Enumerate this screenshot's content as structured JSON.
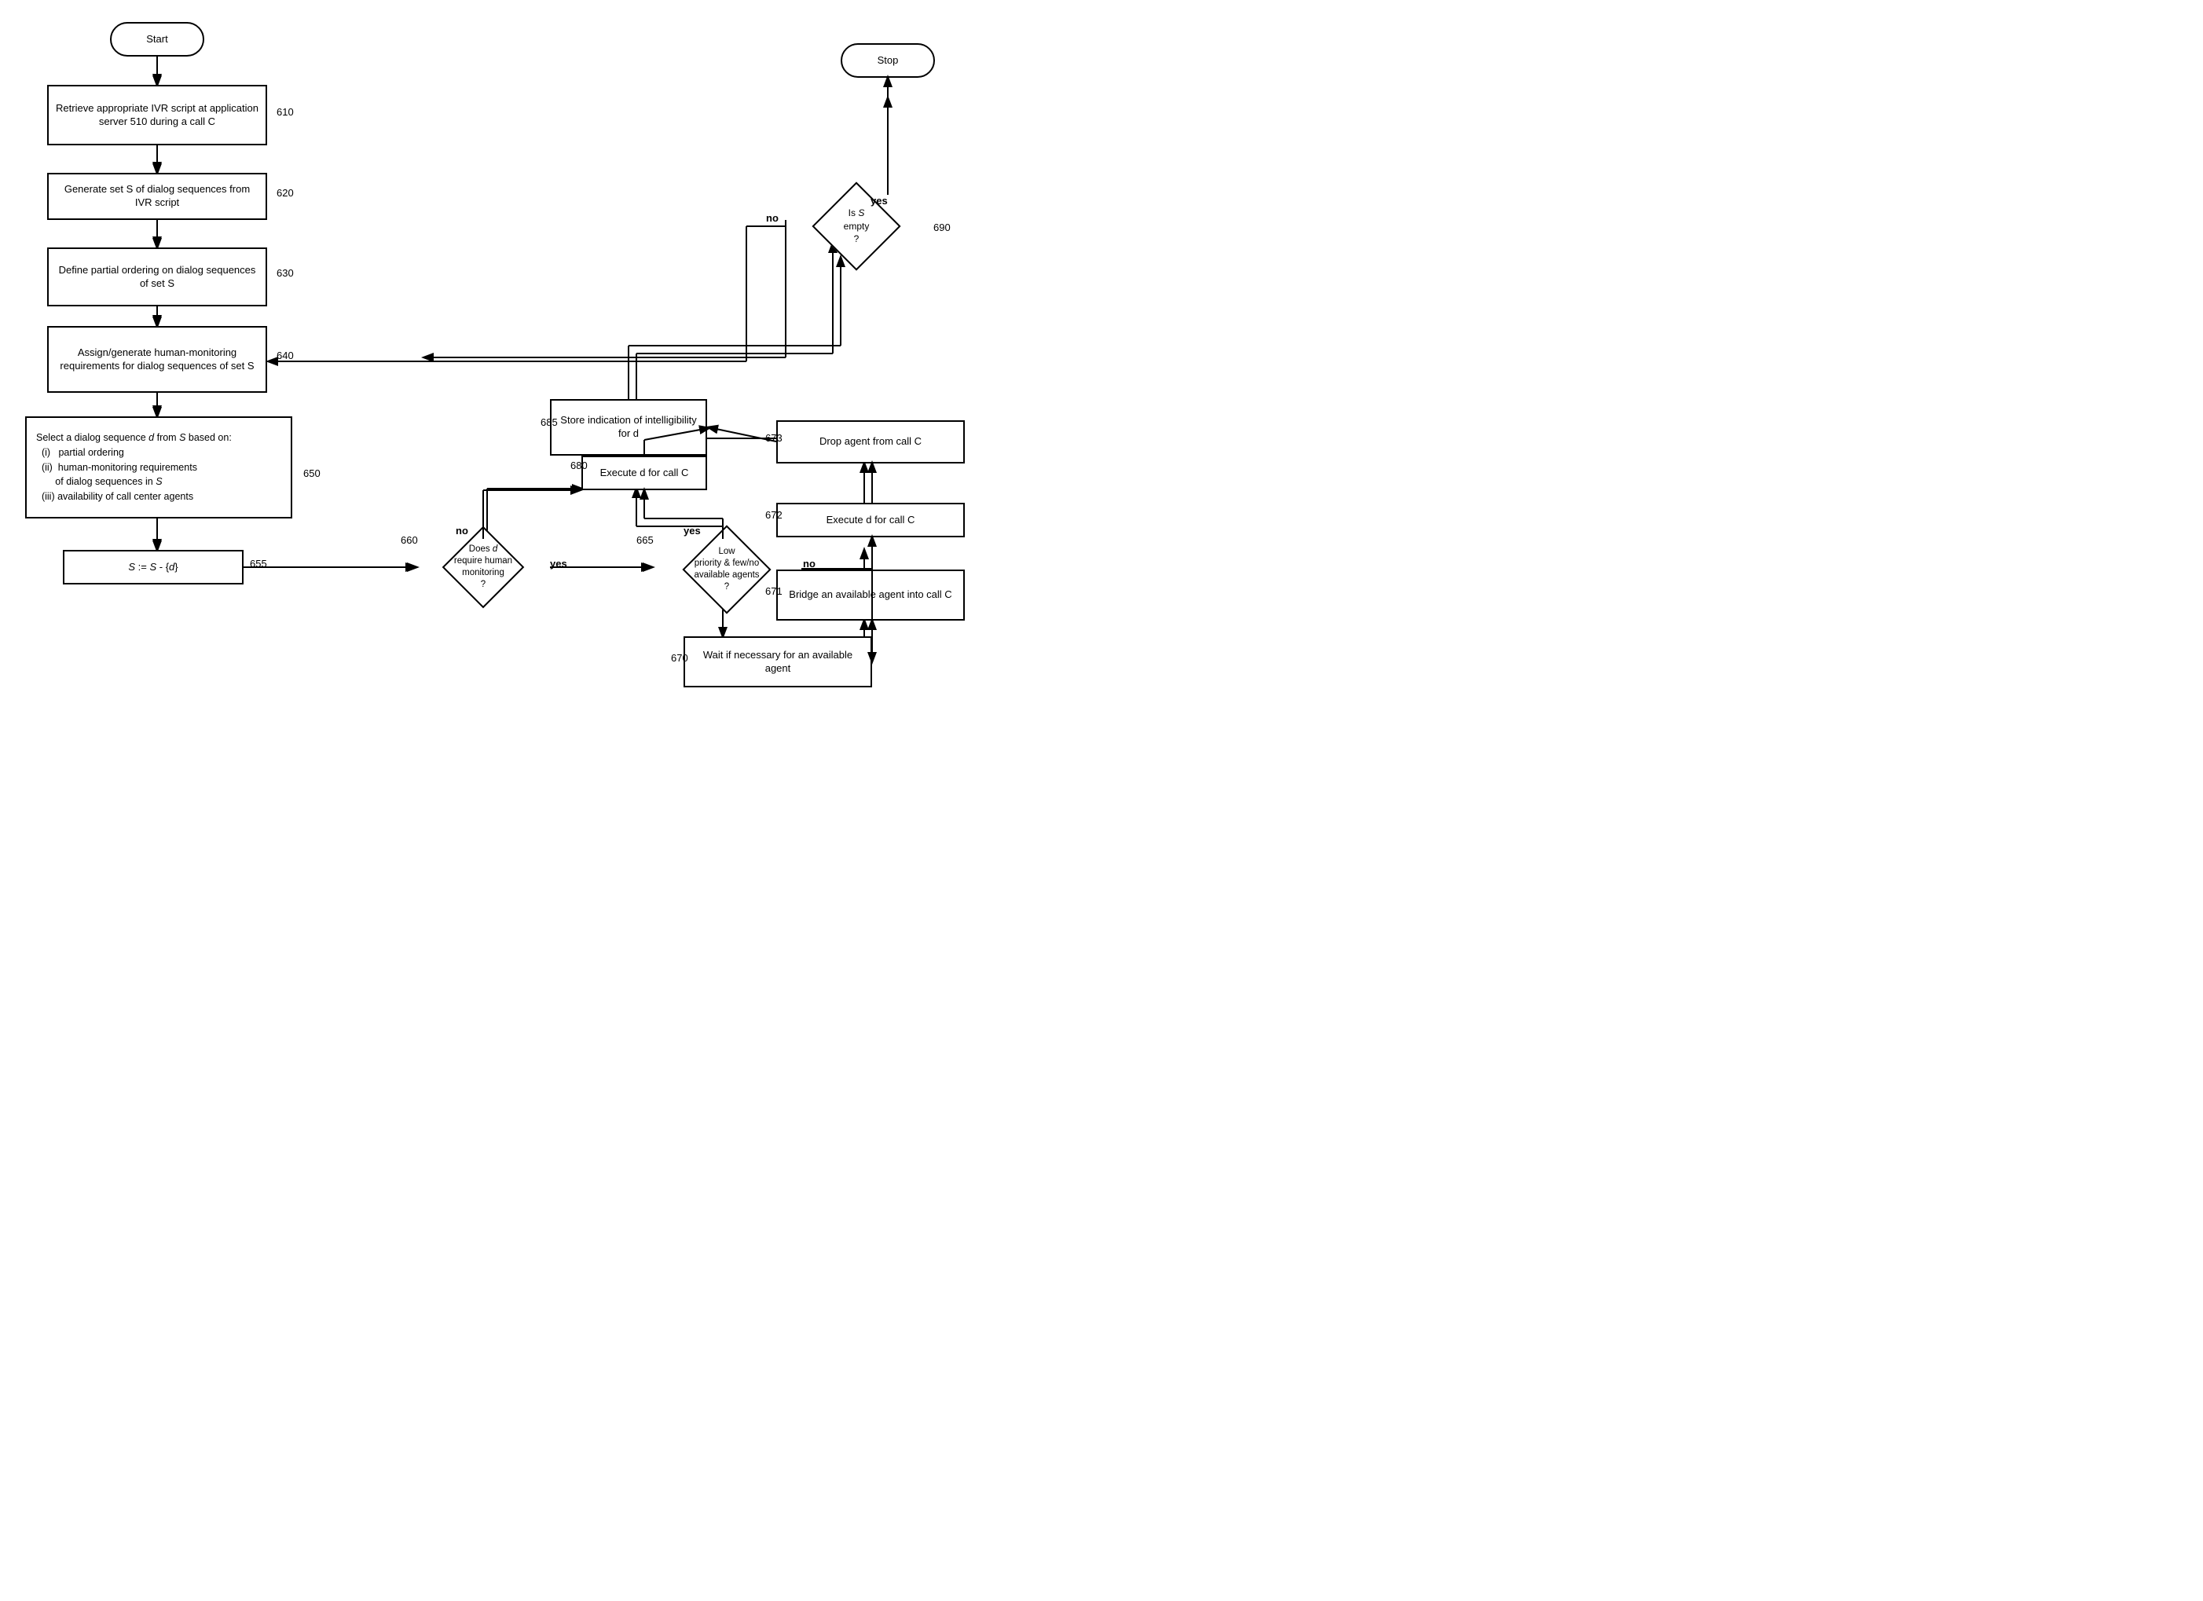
{
  "nodes": {
    "start": {
      "label": "Start"
    },
    "stop": {
      "label": "Stop"
    },
    "n610": {
      "label": "Retrieve appropriate IVR script at application server 510 during a call C",
      "ref": "610"
    },
    "n620": {
      "label": "Generate set S of dialog sequences from IVR script",
      "ref": "620"
    },
    "n630": {
      "label": "Define partial ordering on dialog sequences of set S",
      "ref": "630"
    },
    "n640": {
      "label": "Assign/generate human-monitoring requirements for dialog sequences of set S",
      "ref": "640"
    },
    "n650": {
      "label": "Select a dialog sequence d from S based on:\n(i)   partial ordering\n(ii)  human-monitoring requirements\n       of dialog sequences in S\n(iii) availability of call center agents",
      "ref": "650"
    },
    "n655": {
      "label": "S := S - {d}",
      "ref": "655"
    },
    "n660": {
      "label": "Does d require human monitoring ?",
      "ref": "660"
    },
    "n665": {
      "label": "Low priority & few/no available agents ?",
      "ref": "665"
    },
    "n670": {
      "label": "Wait if necessary for an available agent",
      "ref": "670"
    },
    "n671": {
      "label": "Bridge an available agent into call C",
      "ref": "671"
    },
    "n672": {
      "label": "Execute d for call C",
      "ref": "672"
    },
    "n673": {
      "label": "Drop agent from call C",
      "ref": "673"
    },
    "n680": {
      "label": "Execute d for call C",
      "ref": "680"
    },
    "n685": {
      "label": "Store indication of intelligibility for d",
      "ref": "685"
    },
    "n690": {
      "label": "Is S empty ?",
      "ref": "690"
    }
  },
  "labels": {
    "yes_690": "yes",
    "no_690": "no",
    "yes_660": "yes",
    "no_660": "no",
    "yes_665": "yes",
    "no_665": "no"
  }
}
